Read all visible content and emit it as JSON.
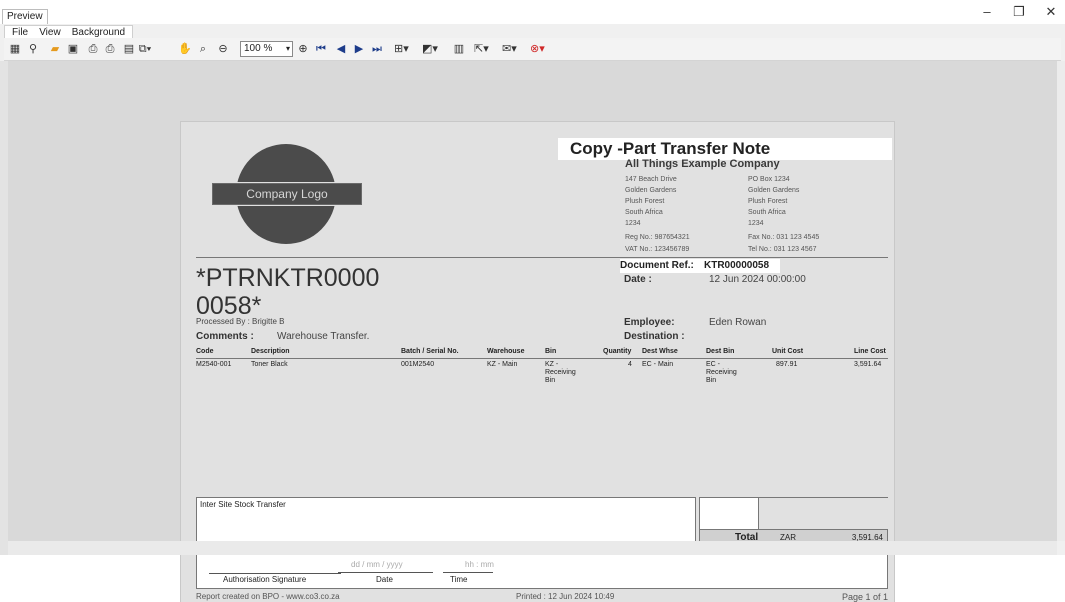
{
  "window": {
    "title": "Preview",
    "minimize": "–",
    "restore": "❐",
    "close": "✕"
  },
  "menu": {
    "items": [
      "File",
      "View",
      "Background"
    ]
  },
  "toolbar": {
    "zoom": "100 %"
  },
  "document": {
    "copy_title": "Copy -Part Transfer Note",
    "logo_text": "Company Logo",
    "company": {
      "name": "All Things Example Company",
      "address": [
        "147 Beach Drive",
        "Golden Gardens",
        "Plush Forest",
        "South Africa",
        "1234"
      ],
      "postal": [
        "PO Box 1234",
        "Golden Gardens",
        "Plush Forest",
        "South Africa",
        "1234"
      ],
      "reg_label": "Reg No.:",
      "reg_value": "987654321",
      "vat_label": "VAT No.:",
      "vat_value": "123456789",
      "fax_label": "Fax No.:",
      "fax_value": "031 123 4545",
      "tel_label": "Tel No.:",
      "tel_value": "031 123 4567"
    },
    "barcode_line1": "*PTRNKTR0000",
    "barcode_line2": "0058*",
    "docref_label": "Document Ref.:",
    "docref_value": "KTR00000058",
    "date_label": "Date :",
    "date_value": "12 Jun 2024 00:00:00",
    "processed_by": "Processed By : Brigitte B",
    "comments_label": "Comments :",
    "comments_value": "Warehouse Transfer.",
    "employee_label": "Employee:",
    "employee_value": "Eden Rowan",
    "destination_label": "Destination :",
    "columns": [
      "Code",
      "Description",
      "Batch / Serial No.",
      "Warehouse",
      "Bin",
      "Quantity",
      "Dest Whse",
      "Dest Bin",
      "Unit Cost",
      "Line Cost"
    ],
    "rows": [
      {
        "code": "M2540-001",
        "description": "Toner Black",
        "batch": "001M2540",
        "warehouse": "KZ - Main",
        "bin": [
          "KZ -",
          "Receiving",
          "Bin"
        ],
        "quantity": "4",
        "dest_whse": "EC - Main",
        "dest_bin": [
          "EC -",
          "Receiving",
          "Bin"
        ],
        "unit_cost": "897.91",
        "line_cost": "3,591.64"
      }
    ],
    "notes": "Inter Site Stock Transfer",
    "total_label": "Total",
    "total_currency": "ZAR",
    "total_value": "3,591.64",
    "sig_label": "Authorisation Signature",
    "date_placeholder": "dd / mm / yyyy",
    "date_caption": "Date",
    "time_placeholder": "hh : mm",
    "time_caption": "Time",
    "footer_left": "Report created on BPO - www.co3.co.za",
    "footer_mid": "Printed : 12 Jun 2024 10:49",
    "footer_right": "Page 1 of 1"
  }
}
